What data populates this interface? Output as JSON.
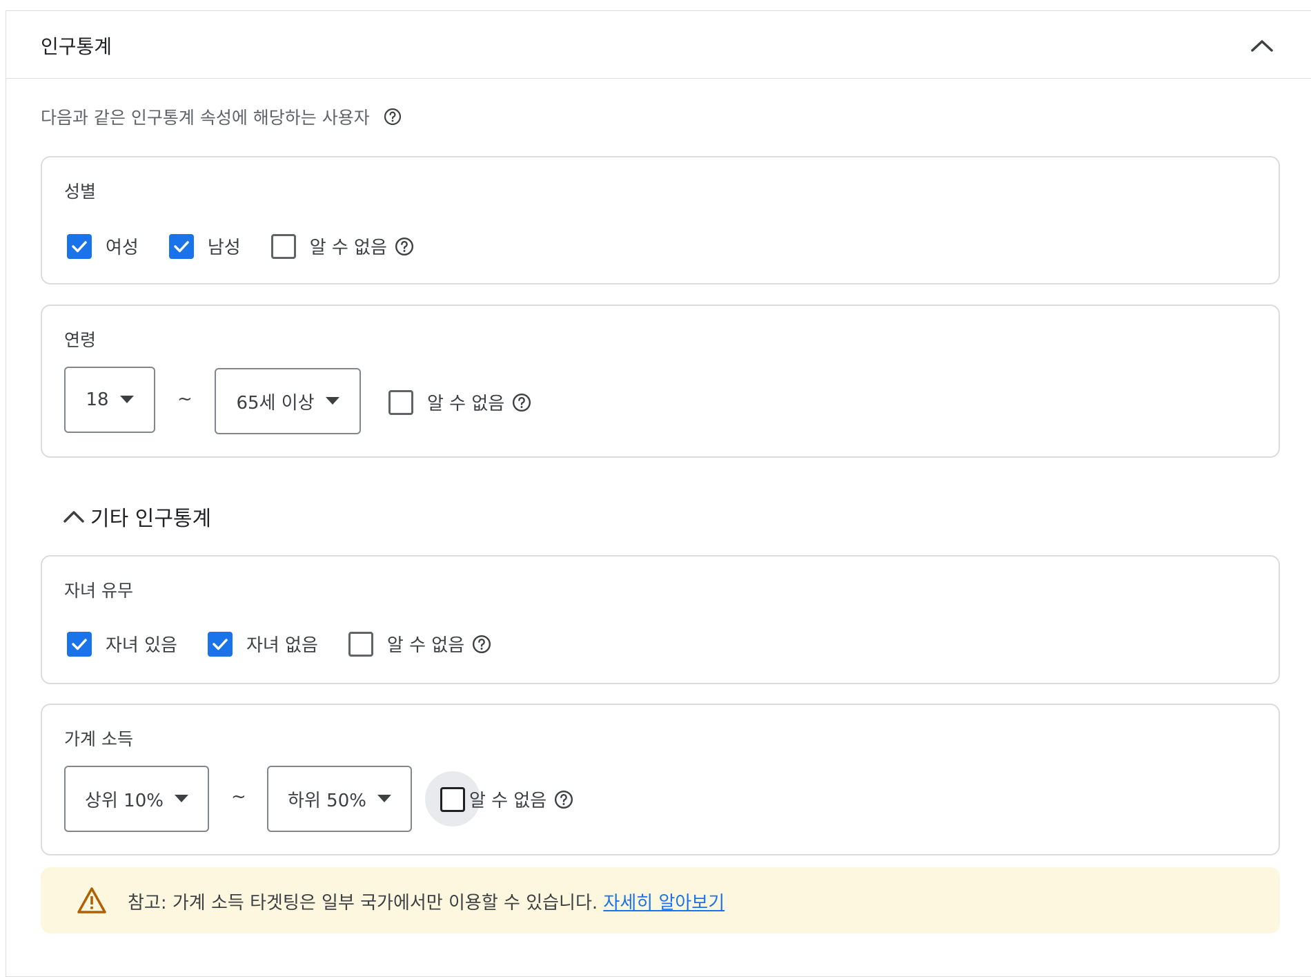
{
  "panel": {
    "title": "인구통계"
  },
  "subtitle": {
    "text": "다음과 같은 인구통계 속성에 해당하는 사용자"
  },
  "gender": {
    "title": "성별",
    "options": [
      {
        "label": "여성",
        "checked": true
      },
      {
        "label": "남성",
        "checked": true
      },
      {
        "label": "알 수 없음",
        "checked": false
      }
    ]
  },
  "age": {
    "title": "연령",
    "from": "18",
    "separator": "~",
    "to": "65세 이상",
    "unknown_label": "알 수 없음",
    "unknown_checked": false
  },
  "other": {
    "toggle_label": "기타 인구통계",
    "expanded": true
  },
  "parental": {
    "title": "자녀 유무",
    "options": [
      {
        "label": "자녀 있음",
        "checked": true
      },
      {
        "label": "자녀 없음",
        "checked": true
      },
      {
        "label": "알 수 없음",
        "checked": false
      }
    ]
  },
  "income": {
    "title": "가계 소득",
    "from": "상위 10%",
    "separator": "~",
    "to": "하위 50%",
    "unknown_label": "알 수 없음",
    "unknown_checked": false
  },
  "notice": {
    "text": "참고: 가계 소득 타겟팅은 일부 국가에서만 이용할 수 있습니다. ",
    "link": "자세히 알아보기"
  },
  "colors": {
    "accent": "#1a73e8",
    "notice_bg": "#fef7e0",
    "warning": "#b06000"
  }
}
